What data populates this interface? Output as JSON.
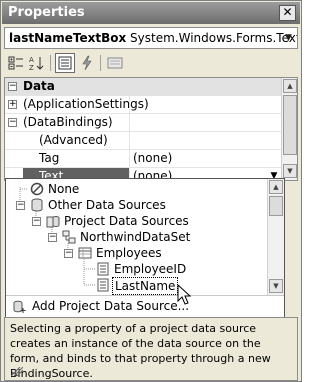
{
  "window": {
    "title": "Properties",
    "close_glyph": "✕"
  },
  "object_selector": {
    "name": "lastNameTextBox",
    "type": "System.Windows.Forms.TextBox"
  },
  "toolbar": {
    "buttons": [
      "categorized-icon",
      "alphabetical-icon",
      "properties-icon",
      "events-icon",
      "property-pages-icon"
    ],
    "selected": "properties-icon"
  },
  "grid": {
    "rows": [
      {
        "kind": "category",
        "expander": "⊟",
        "name": "Data",
        "value": ""
      },
      {
        "kind": "group",
        "expander": "+",
        "name": "(ApplicationSettings)",
        "value": ""
      },
      {
        "kind": "group",
        "expander": "−",
        "name": "(DataBindings)",
        "value": ""
      },
      {
        "kind": "sub",
        "name": "(Advanced)",
        "value": ""
      },
      {
        "kind": "sub",
        "name": "Tag",
        "value": "(none)"
      },
      {
        "kind": "active",
        "name": "Text",
        "value": "(none)"
      }
    ]
  },
  "datasource_dropdown": {
    "items": [
      {
        "label": "None",
        "icon": "none-icon"
      },
      {
        "label": "Other Data Sources",
        "icon": "datasource-icon"
      },
      {
        "label": "Project Data Sources",
        "icon": "project-datasource-icon"
      },
      {
        "label": "NorthwindDataSet",
        "icon": "dataset-icon"
      },
      {
        "label": "Employees",
        "icon": "table-icon"
      },
      {
        "label": "EmployeeID",
        "icon": "field-icon"
      },
      {
        "label": "LastName",
        "icon": "field-icon"
      }
    ],
    "add_label": "Add Project Data Source..."
  },
  "description": "Selecting a property of a project data source creates an instance of the data source on the form, and binds to that property through a new BindingSource.",
  "colors": {
    "titlebar": "#7f7f7f",
    "active_row": "#606060",
    "panel": "#ece9d8"
  }
}
